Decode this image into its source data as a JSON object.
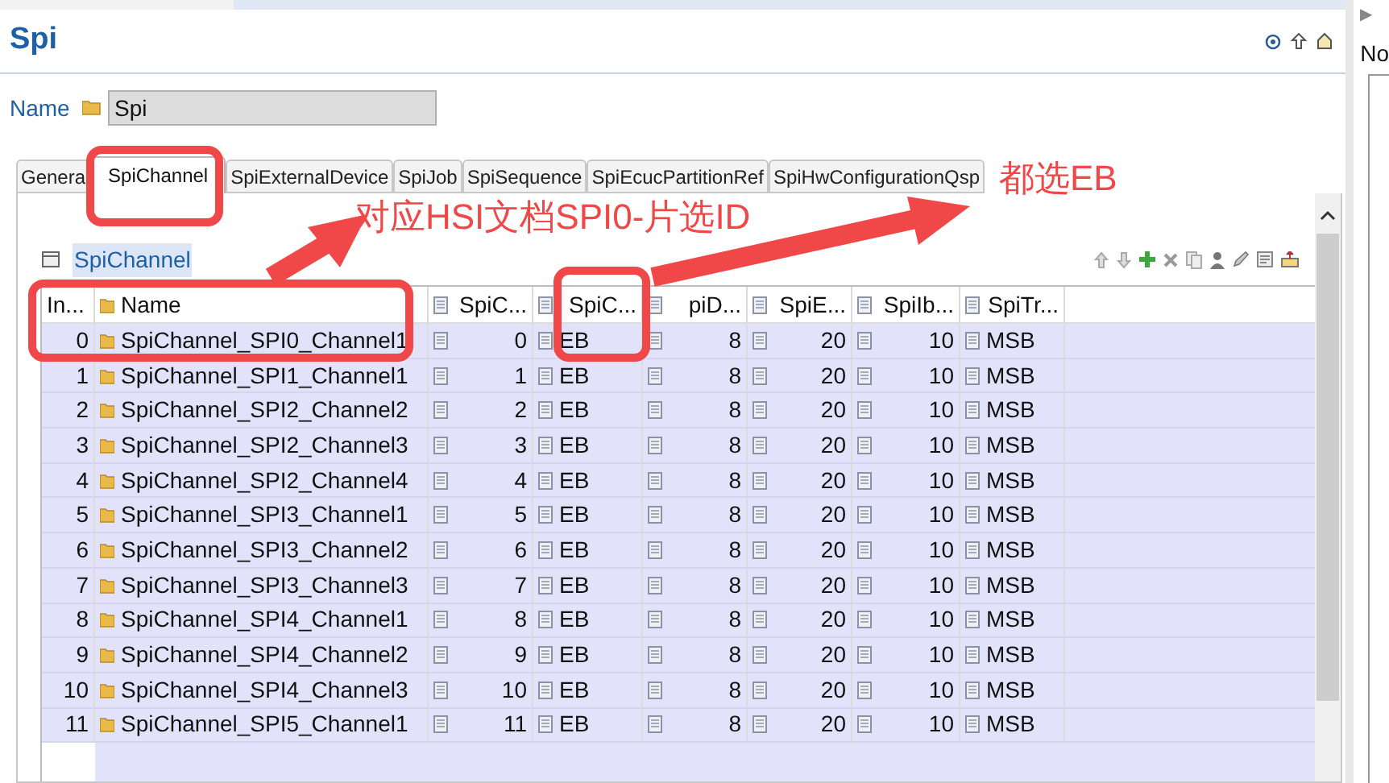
{
  "editor": {
    "title": "Spi",
    "name_label": "Name",
    "name_value": "Spi"
  },
  "tabs": [
    {
      "label": "Genera",
      "selected": false
    },
    {
      "label": "SpiChannel",
      "selected": true
    },
    {
      "label": "SpiExternalDevice",
      "selected": false
    },
    {
      "label": "SpiJob",
      "selected": false
    },
    {
      "label": "SpiSequence",
      "selected": false
    },
    {
      "label": "SpiEcucPartitionRef",
      "selected": false
    },
    {
      "label": "SpiHwConfigurationQsp",
      "selected": false
    }
  ],
  "section": {
    "title": "SpiChannel"
  },
  "table": {
    "columns": [
      "In...",
      "Name",
      "SpiC...",
      "SpiC...",
      "piD...",
      "SpiE...",
      "SpiIb...",
      "SpiTr..."
    ],
    "rows": [
      {
        "cells": [
          "0",
          "SpiChannel_SPI0_Channel1",
          "0",
          "EB",
          "8",
          "20",
          "10",
          "MSB"
        ]
      },
      {
        "cells": [
          "1",
          "SpiChannel_SPI1_Channel1",
          "1",
          "EB",
          "8",
          "20",
          "10",
          "MSB"
        ]
      },
      {
        "cells": [
          "2",
          "SpiChannel_SPI2_Channel2",
          "2",
          "EB",
          "8",
          "20",
          "10",
          "MSB"
        ]
      },
      {
        "cells": [
          "3",
          "SpiChannel_SPI2_Channel3",
          "3",
          "EB",
          "8",
          "20",
          "10",
          "MSB"
        ]
      },
      {
        "cells": [
          "4",
          "SpiChannel_SPI2_Channel4",
          "4",
          "EB",
          "8",
          "20",
          "10",
          "MSB"
        ]
      },
      {
        "cells": [
          "5",
          "SpiChannel_SPI3_Channel1",
          "5",
          "EB",
          "8",
          "20",
          "10",
          "MSB"
        ]
      },
      {
        "cells": [
          "6",
          "SpiChannel_SPI3_Channel2",
          "6",
          "EB",
          "8",
          "20",
          "10",
          "MSB"
        ]
      },
      {
        "cells": [
          "7",
          "SpiChannel_SPI3_Channel3",
          "7",
          "EB",
          "8",
          "20",
          "10",
          "MSB"
        ]
      },
      {
        "cells": [
          "8",
          "SpiChannel_SPI4_Channel1",
          "8",
          "EB",
          "8",
          "20",
          "10",
          "MSB"
        ]
      },
      {
        "cells": [
          "9",
          "SpiChannel_SPI4_Channel2",
          "9",
          "EB",
          "8",
          "20",
          "10",
          "MSB"
        ]
      },
      {
        "cells": [
          "10",
          "SpiChannel_SPI4_Channel3",
          "10",
          "EB",
          "8",
          "20",
          "10",
          "MSB"
        ]
      },
      {
        "cells": [
          "11",
          "SpiChannel_SPI5_Channel1",
          "11",
          "EB",
          "8",
          "20",
          "10",
          "MSB"
        ]
      }
    ]
  },
  "annotations": [
    {
      "text": "对应HSI文档SPI0-片选ID"
    },
    {
      "text": "都选EB"
    }
  ],
  "side_panel": {
    "arrow": "▶",
    "label": "No"
  }
}
